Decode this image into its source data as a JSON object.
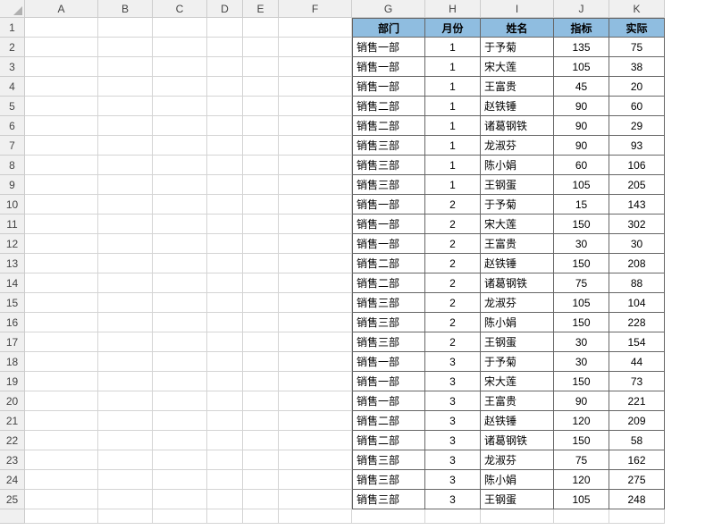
{
  "columns": [
    "A",
    "B",
    "C",
    "D",
    "E",
    "F",
    "G",
    "H",
    "I",
    "J",
    "K"
  ],
  "rows": [
    1,
    2,
    3,
    4,
    5,
    6,
    7,
    8,
    9,
    10,
    11,
    12,
    13,
    14,
    15,
    16,
    17,
    18,
    19,
    20,
    21,
    22,
    23,
    24,
    25
  ],
  "headers": {
    "dept": "部门",
    "month": "月份",
    "name": "姓名",
    "target": "指标",
    "actual": "实际"
  },
  "chart_data": {
    "type": "table",
    "title": "",
    "columns": [
      "部门",
      "月份",
      "姓名",
      "指标",
      "实际"
    ],
    "rows": [
      {
        "dept": "销售一部",
        "month": 1,
        "name": "于予菊",
        "target": 135,
        "actual": 75
      },
      {
        "dept": "销售一部",
        "month": 1,
        "name": "宋大莲",
        "target": 105,
        "actual": 38
      },
      {
        "dept": "销售一部",
        "month": 1,
        "name": "王富贵",
        "target": 45,
        "actual": 20
      },
      {
        "dept": "销售二部",
        "month": 1,
        "name": "赵铁锤",
        "target": 90,
        "actual": 60
      },
      {
        "dept": "销售二部",
        "month": 1,
        "name": "诸葛钢铁",
        "target": 90,
        "actual": 29
      },
      {
        "dept": "销售三部",
        "month": 1,
        "name": "龙淑芬",
        "target": 90,
        "actual": 93
      },
      {
        "dept": "销售三部",
        "month": 1,
        "name": "陈小娟",
        "target": 60,
        "actual": 106
      },
      {
        "dept": "销售三部",
        "month": 1,
        "name": "王钢蛋",
        "target": 105,
        "actual": 205
      },
      {
        "dept": "销售一部",
        "month": 2,
        "name": "于予菊",
        "target": 15,
        "actual": 143
      },
      {
        "dept": "销售一部",
        "month": 2,
        "name": "宋大莲",
        "target": 150,
        "actual": 302
      },
      {
        "dept": "销售一部",
        "month": 2,
        "name": "王富贵",
        "target": 30,
        "actual": 30
      },
      {
        "dept": "销售二部",
        "month": 2,
        "name": "赵铁锤",
        "target": 150,
        "actual": 208
      },
      {
        "dept": "销售二部",
        "month": 2,
        "name": "诸葛钢铁",
        "target": 75,
        "actual": 88
      },
      {
        "dept": "销售三部",
        "month": 2,
        "name": "龙淑芬",
        "target": 105,
        "actual": 104
      },
      {
        "dept": "销售三部",
        "month": 2,
        "name": "陈小娟",
        "target": 150,
        "actual": 228
      },
      {
        "dept": "销售三部",
        "month": 2,
        "name": "王钢蛋",
        "target": 30,
        "actual": 154
      },
      {
        "dept": "销售一部",
        "month": 3,
        "name": "于予菊",
        "target": 30,
        "actual": 44
      },
      {
        "dept": "销售一部",
        "month": 3,
        "name": "宋大莲",
        "target": 150,
        "actual": 73
      },
      {
        "dept": "销售一部",
        "month": 3,
        "name": "王富贵",
        "target": 90,
        "actual": 221
      },
      {
        "dept": "销售二部",
        "month": 3,
        "name": "赵铁锤",
        "target": 120,
        "actual": 209
      },
      {
        "dept": "销售二部",
        "month": 3,
        "name": "诸葛钢铁",
        "target": 150,
        "actual": 58
      },
      {
        "dept": "销售三部",
        "month": 3,
        "name": "龙淑芬",
        "target": 75,
        "actual": 162
      },
      {
        "dept": "销售三部",
        "month": 3,
        "name": "陈小娟",
        "target": 120,
        "actual": 275
      },
      {
        "dept": "销售三部",
        "month": 3,
        "name": "王钢蛋",
        "target": 105,
        "actual": 248
      }
    ]
  }
}
